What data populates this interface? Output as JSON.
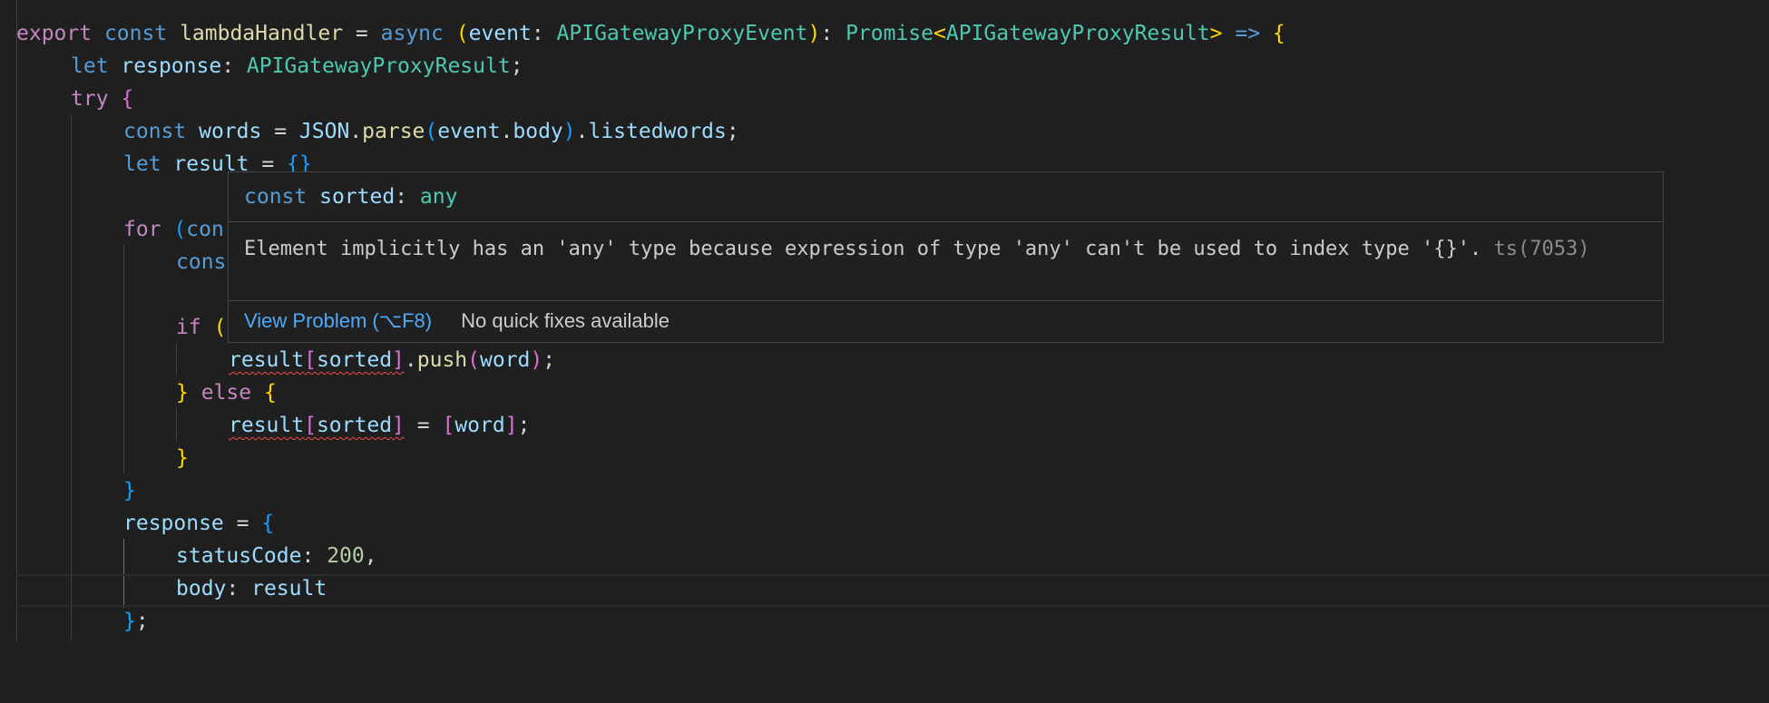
{
  "code": {
    "line1": {
      "kw_export": "export",
      "kw_const": "const",
      "name": "lambdaHandler",
      "eq": " = ",
      "kw_async": "async",
      "open": "(",
      "param": "event",
      "colon": ": ",
      "param_type": "APIGatewayProxyEvent",
      "close": ")",
      "colon2": ": ",
      "ret_promise": "Promise",
      "lt": "<",
      "ret_type": "APIGatewayProxyResult",
      "gt": ">",
      "arrow": " => ",
      "brace": "{"
    },
    "line2": {
      "kw": "let",
      "name": "response",
      "colon": ": ",
      "type": "APIGatewayProxyResult",
      "semi": ";"
    },
    "line3": {
      "kw": "try",
      "brace": "{"
    },
    "line4": {
      "kw": "const",
      "name": "words",
      "eq": " = ",
      "obj": "JSON",
      "dot": ".",
      "fn": "parse",
      "open": "(",
      "arg": "event",
      "dot2": ".",
      "prop": "body",
      "close": ")",
      "dot3": ".",
      "prop2": "listedwords",
      "semi": ";"
    },
    "line5": {
      "kw": "let",
      "name": "result",
      "eq": " = ",
      "val": "{}"
    },
    "line7": {
      "kw": "for",
      "open": "(",
      "partial": "con"
    },
    "line8": {
      "partial": "cons"
    },
    "line10": {
      "kw": "if",
      "open": "("
    },
    "line11": {
      "obj": "result",
      "open": "[",
      "key": "sorted",
      "close": "]",
      "dot": ".",
      "fn": "push",
      "popen": "(",
      "arg": "word",
      "pclose": ")",
      "semi": ";"
    },
    "line12": {
      "close": "}",
      "kw": "else",
      "open": "{"
    },
    "line13": {
      "obj": "result",
      "open": "[",
      "key": "sorted",
      "close": "]",
      "eq": " = ",
      "aopen": "[",
      "val": "word",
      "aclose": "]",
      "semi": ";"
    },
    "line14": {
      "close": "}"
    },
    "line15": {
      "close": "}"
    },
    "line16": {
      "name": "response",
      "eq": " = ",
      "open": "{"
    },
    "line17": {
      "key": "statusCode",
      "colon": ": ",
      "val": "200",
      "comma": ","
    },
    "line18": {
      "key": "body",
      "colon": ": ",
      "val": "result"
    },
    "line19": {
      "close": "}",
      "semi": ";"
    }
  },
  "hover": {
    "signature": {
      "kw": "const",
      "name": "sorted",
      "colon": ": ",
      "type": "any"
    },
    "message": "Element implicitly has an 'any' type because expression of type 'any' can't be used to index type '{}'.",
    "code": "ts(7053)",
    "view_problem": "View Problem (⌥F8)",
    "no_fixes": "No quick fixes available"
  },
  "colors": {
    "background": "#1f1f1f",
    "keyword": "#569cd6",
    "control": "#c586c0",
    "variable": "#9cdcfe",
    "type": "#4ec9b0",
    "function": "#dcdcaa",
    "number": "#b5cea8",
    "bracket1": "#ffd700",
    "bracket2": "#da70d6",
    "bracket3": "#179fff",
    "error": "#f14c4c",
    "link": "#4daafc"
  }
}
